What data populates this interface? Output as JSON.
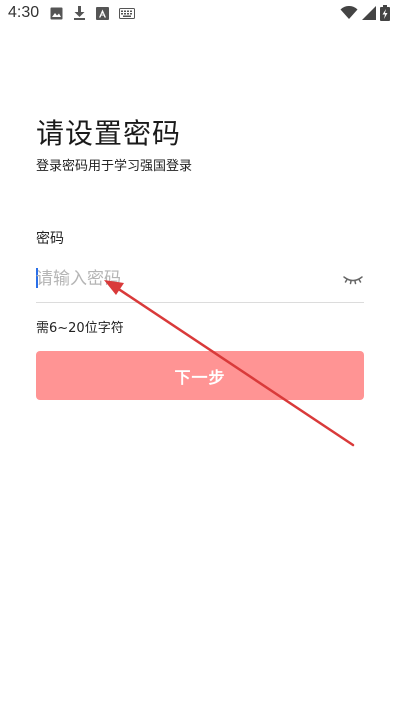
{
  "status_bar": {
    "time": "4:30",
    "left_icons": [
      "image-icon",
      "download-icon",
      "font-a-icon",
      "keyboard-icon"
    ],
    "right_icons": [
      "wifi-icon",
      "signal-icon",
      "battery-charging-icon"
    ]
  },
  "header": {
    "title": "请设置密码",
    "subtitle": "登录密码用于学习强国登录"
  },
  "form": {
    "password_label": "密码",
    "password_placeholder": "请输入密码",
    "password_value": "",
    "hint": "需6~20位字符",
    "eye_icon": "eye-closed-icon"
  },
  "actions": {
    "next_label": "下一步"
  },
  "colors": {
    "button_bg": "#ff9494",
    "caret": "#2a6fe8",
    "arrow": "#d93a3a"
  }
}
